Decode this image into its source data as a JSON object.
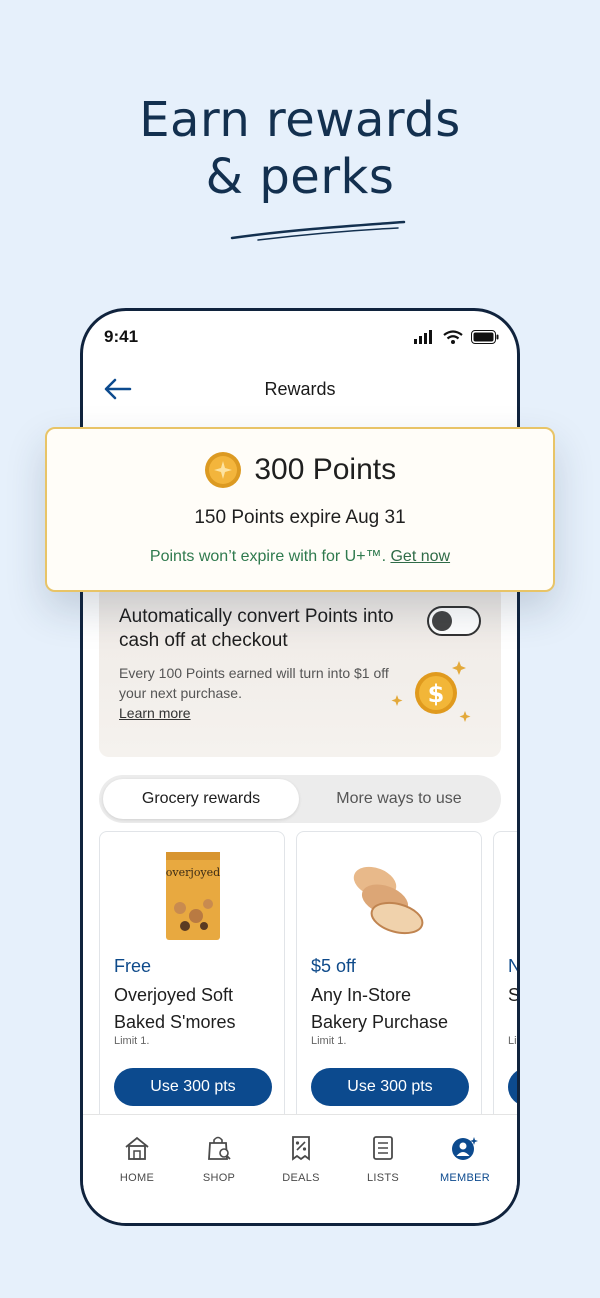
{
  "headline": {
    "line1": "Earn rewards",
    "line2": "& perks"
  },
  "status": {
    "time": "9:41"
  },
  "header": {
    "title": "Rewards"
  },
  "points_card": {
    "points": "300 Points",
    "expire_count": "150 Points",
    "expire_text": "expire Aug 31",
    "promo_text": "Points won’t expire with for U+™.",
    "promo_link": "Get now"
  },
  "convert": {
    "title": "Automatically convert Points into cash off at checkout",
    "description": "Every 100 Points earned will turn into $1 off your next purchase.",
    "learn_more": "Learn more",
    "toggle_on": false
  },
  "tabs": [
    {
      "label": "Grocery rewards",
      "active": true
    },
    {
      "label": "More ways to use",
      "active": false
    }
  ],
  "rewards": [
    {
      "deal": "Free",
      "name": "Overjoyed Soft Baked S'mores",
      "limit": "Limit 1.",
      "button": "Use 300 pts",
      "image": "cookie-bag-image"
    },
    {
      "deal": "$5 off",
      "name": "Any In-Store Bakery Purchase",
      "limit": "Limit 1.",
      "button": "Use 300 pts",
      "image": "bread-image"
    },
    {
      "deal": "N",
      "name": "S m",
      "limit": "Li",
      "button": "",
      "image": ""
    }
  ],
  "bottom_nav": [
    {
      "label": "HOME",
      "icon": "home-icon"
    },
    {
      "label": "SHOP",
      "icon": "shop-bag-icon"
    },
    {
      "label": "DEALS",
      "icon": "deals-tag-icon"
    },
    {
      "label": "LISTS",
      "icon": "list-icon"
    },
    {
      "label": "MEMBER",
      "icon": "member-icon",
      "active": true
    }
  ],
  "colors": {
    "brand_blue": "#0c4a8e",
    "gold": "#e8c467",
    "headline": "#13304f",
    "promo_green": "#2f7a4e"
  }
}
